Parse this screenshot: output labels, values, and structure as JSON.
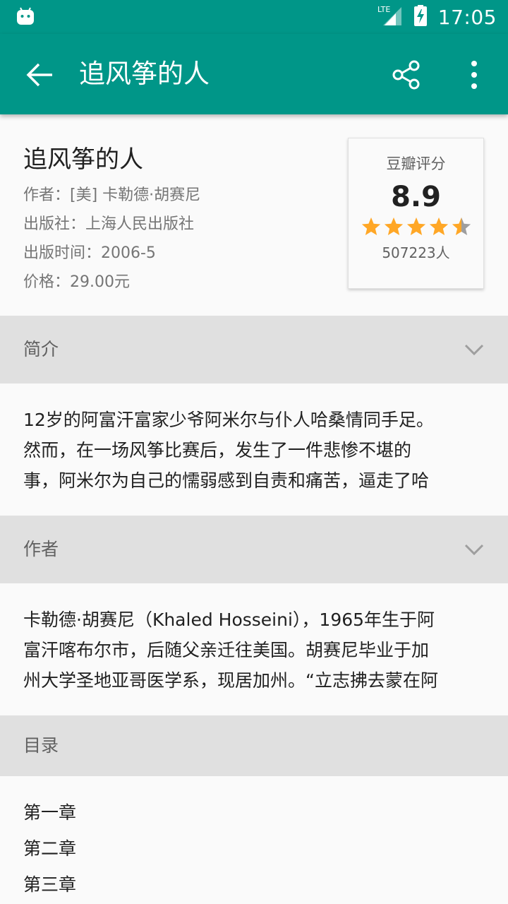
{
  "status_bar": {
    "time": "17:05",
    "network": "LTE",
    "icons": [
      "android-icon",
      "lte-signal-icon",
      "battery-charging-icon"
    ]
  },
  "app_bar": {
    "title": "追风筝的人",
    "icons": [
      "back-arrow-icon",
      "share-icon",
      "more-vert-icon"
    ]
  },
  "book": {
    "title": "追风筝的人",
    "author": "作者：[美] 卡勒德·胡赛尼",
    "publisher": "出版社：上海人民出版社",
    "pub_date": "出版时间：2006-5",
    "price": "价格：29.00元"
  },
  "rating": {
    "label": "豆瓣评分",
    "score": "8.9",
    "count": "507223人",
    "stars_filled": 4.5,
    "stars_total": 5,
    "star_color": "#ffa726"
  },
  "sections": {
    "summary": {
      "title": "简介",
      "lines": [
        "12岁的阿富汗富家少爷阿米尔与仆人哈桑情同手足。",
        "然而，在一场风筝比赛后，发生了一件悲惨不堪的",
        "事，阿米尔为自己的懦弱感到自责和痛苦，逼走了哈"
      ]
    },
    "author": {
      "title": "作者",
      "lines": [
        "卡勒德·胡赛尼（Khaled Hosseini），1965年生于阿",
        "富汗喀布尔市，后随父亲迁往美国。胡赛尼毕业于加",
        "州大学圣地亚哥医学系，现居加州。“立志拂去蒙在阿"
      ]
    },
    "catalog": {
      "title": "目录",
      "items": [
        "第一章",
        "第二章",
        "第三章"
      ]
    }
  },
  "colors": {
    "primary": "#009688",
    "section_header_bg": "#e0e0e0",
    "background": "#fafafa"
  }
}
